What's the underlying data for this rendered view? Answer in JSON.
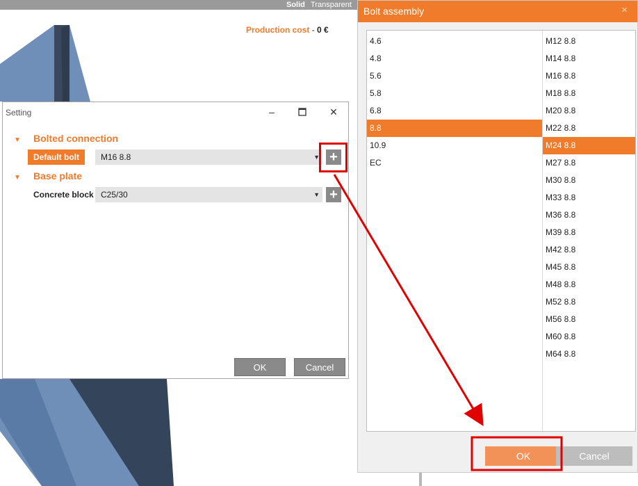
{
  "background_app": {
    "view_modes": {
      "solid": "Solid",
      "transparent": "Transparent"
    },
    "production_cost": {
      "label": "Production cost",
      "separator": "-",
      "value": "0 €"
    }
  },
  "setting_dialog": {
    "title": "Setting",
    "window_controls": [
      "minimize-icon",
      "maximize-icon",
      "close-icon"
    ],
    "sections": [
      {
        "label": "Bolted connection",
        "rows": [
          {
            "label": "Default bolt",
            "value": "M16 8.8"
          }
        ]
      },
      {
        "label": "Base plate",
        "rows": [
          {
            "label": "Concrete block",
            "value": "C25/30"
          }
        ]
      }
    ],
    "ok_label": "OK",
    "cancel_label": "Cancel"
  },
  "bolt_dialog": {
    "title": "Bolt assembly",
    "close_glyph": "×",
    "grades": [
      "4.6",
      "4.8",
      "5.6",
      "5.8",
      "6.8",
      "8.8",
      "10.9",
      "EC"
    ],
    "selected_grade": "8.8",
    "sizes": [
      "M12 8.8",
      "M14 8.8",
      "M16 8.8",
      "M18 8.8",
      "M20 8.8",
      "M22 8.8",
      "M24 8.8",
      "M27 8.8",
      "M30 8.8",
      "M33 8.8",
      "M36 8.8",
      "M39 8.8",
      "M42 8.8",
      "M45 8.8",
      "M48 8.8",
      "M52 8.8",
      "M56 8.8",
      "M60 8.8",
      "M64 8.8"
    ],
    "selected_size": "M24 8.8",
    "ok_label": "OK",
    "cancel_label": "Cancel"
  },
  "colors": {
    "accent": "#f07b2a",
    "highlight": "#e00000"
  }
}
